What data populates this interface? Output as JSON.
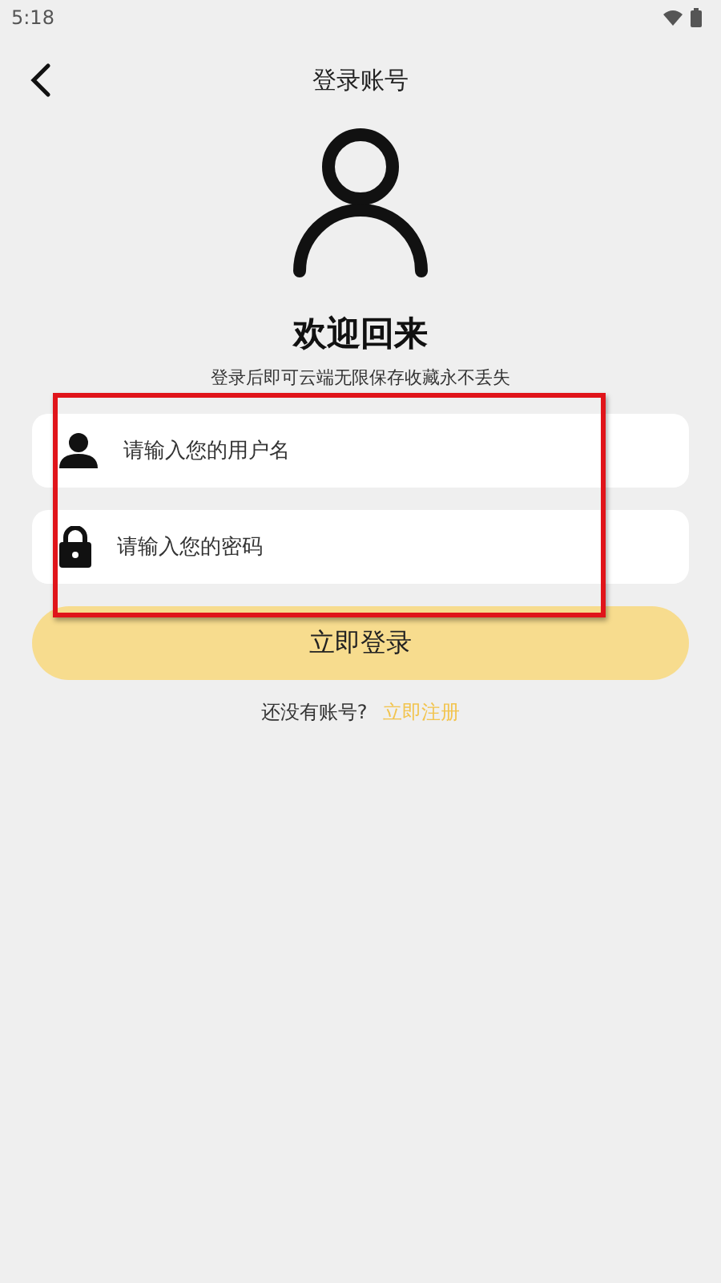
{
  "status_bar": {
    "time": "5:18"
  },
  "header": {
    "title": "登录账号"
  },
  "welcome": {
    "title": "欢迎回来",
    "subtitle": "登录后即可云端无限保存收藏永不丢失"
  },
  "fields": [
    {
      "kind": "user",
      "placeholder": "请输入您的用户名"
    },
    {
      "kind": "lock",
      "placeholder": "请输入您的密码"
    }
  ],
  "login_button": "立即登录",
  "register": {
    "prompt": "还没有账号?",
    "link": "立即注册"
  }
}
